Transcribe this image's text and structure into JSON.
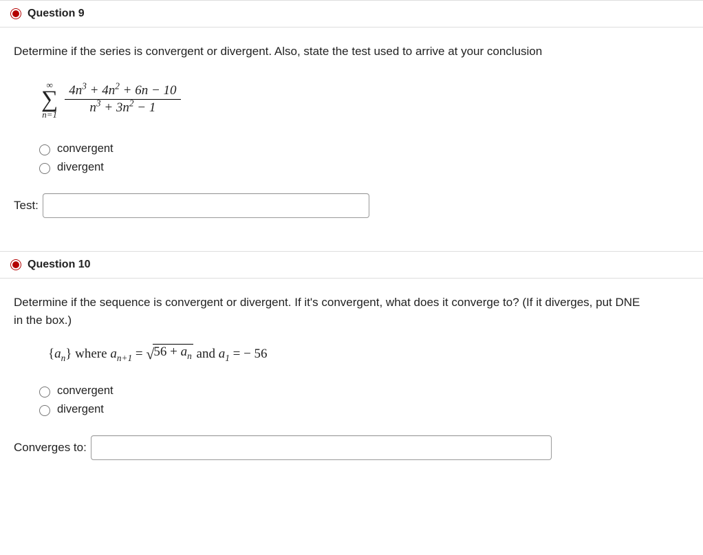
{
  "q9": {
    "title": "Question 9",
    "prompt": "Determine if the series is convergent or divergent. Also, state the test used to arrive at your conclusion",
    "sigma_top": "∞",
    "sigma_bottom": "n=1",
    "frac_num": "4n³ + 4n² + 6n − 10",
    "frac_den": "n³ + 3n² − 1",
    "option1": "convergent",
    "option2": "divergent",
    "test_label": "Test:",
    "test_value": ""
  },
  "q10": {
    "title": "Question 10",
    "prompt": "Determine if the sequence is convergent or divergent. If it's convergent, what does it converge to? (If it diverges, put DNE in the box.)",
    "seq_prefix": "{aₙ} where a",
    "seq_sub1": "n+1",
    "seq_eq1": " = ",
    "sqrt_body": "56 + aₙ",
    "seq_and": " and a",
    "seq_sub2": "1",
    "seq_eq2": " =  − 56",
    "option1": "convergent",
    "option2": "divergent",
    "conv_label": "Converges to:",
    "conv_value": ""
  }
}
